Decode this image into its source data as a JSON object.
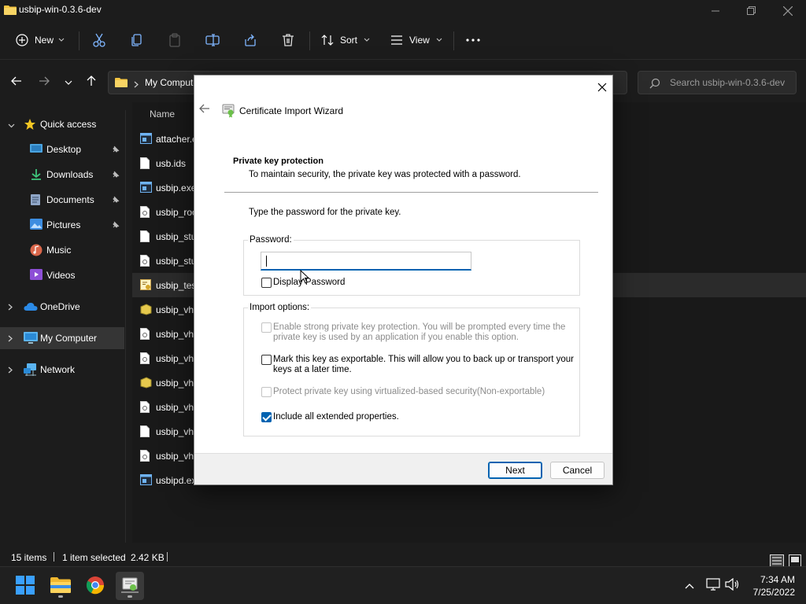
{
  "window": {
    "title": "usbip-win-0.3.6-dev"
  },
  "toolbar": {
    "new_label": "New",
    "sort_label": "Sort",
    "view_label": "View"
  },
  "address": {
    "path_root": "My Computer",
    "search_placeholder": "Search usbip-win-0.3.6-dev"
  },
  "sidebar": {
    "items": [
      {
        "label": "Quick access",
        "icon": "star-icon"
      },
      {
        "label": "Desktop",
        "icon": "desktop-icon",
        "pinned": true
      },
      {
        "label": "Downloads",
        "icon": "download-icon",
        "pinned": true
      },
      {
        "label": "Documents",
        "icon": "document-icon",
        "pinned": true
      },
      {
        "label": "Pictures",
        "icon": "picture-icon",
        "pinned": true
      },
      {
        "label": "Music",
        "icon": "music-icon"
      },
      {
        "label": "Videos",
        "icon": "video-icon"
      },
      {
        "label": "OneDrive",
        "icon": "cloud-icon"
      },
      {
        "label": "My Computer",
        "icon": "computer-icon",
        "selected": true
      },
      {
        "label": "Network",
        "icon": "network-icon"
      }
    ]
  },
  "files": {
    "column_name": "Name",
    "rows": [
      "attacher.e",
      "usb.ids",
      "usbip.exe",
      "usbip_roo",
      "usbip_stu",
      "usbip_stu",
      "usbip_tes",
      "usbip_vh",
      "usbip_vh",
      "usbip_vh",
      "usbip_vh",
      "usbip_vh",
      "usbip_vh",
      "usbip_vh",
      "usbipd.ex"
    ]
  },
  "status": {
    "item_count": "15 items",
    "selection": "1 item selected",
    "size": "2.42 KB"
  },
  "dialog": {
    "title": "Certificate Import Wizard",
    "section_heading": "Private key protection",
    "section_desc": "To maintain security, the private key was protected with a password.",
    "instruction": "Type the password for the private key.",
    "password_label": "Password:",
    "password_value": "",
    "display_password_label": "Display Password",
    "import_options_label": "Import options:",
    "options": {
      "strong_protection_line1": "Enable strong private key protection. You will be prompted every time the",
      "strong_protection_line2": "private key is used by an application if you enable this option.",
      "exportable_line1": "Mark this key as exportable. This will allow you to back up or transport your",
      "exportable_line2": "keys at a later time.",
      "vbs": "Protect private key using virtualized-based security(Non-exportable)",
      "extended": "Include all extended properties."
    },
    "next_label": "Next",
    "cancel_label": "Cancel"
  },
  "taskbar": {
    "time": "7:34 AM",
    "date": "7/25/2022"
  },
  "colors": {
    "accent": "#0063b1",
    "explorer_bg": "#1c1c1c",
    "dialog_bg": "#ffffff"
  }
}
